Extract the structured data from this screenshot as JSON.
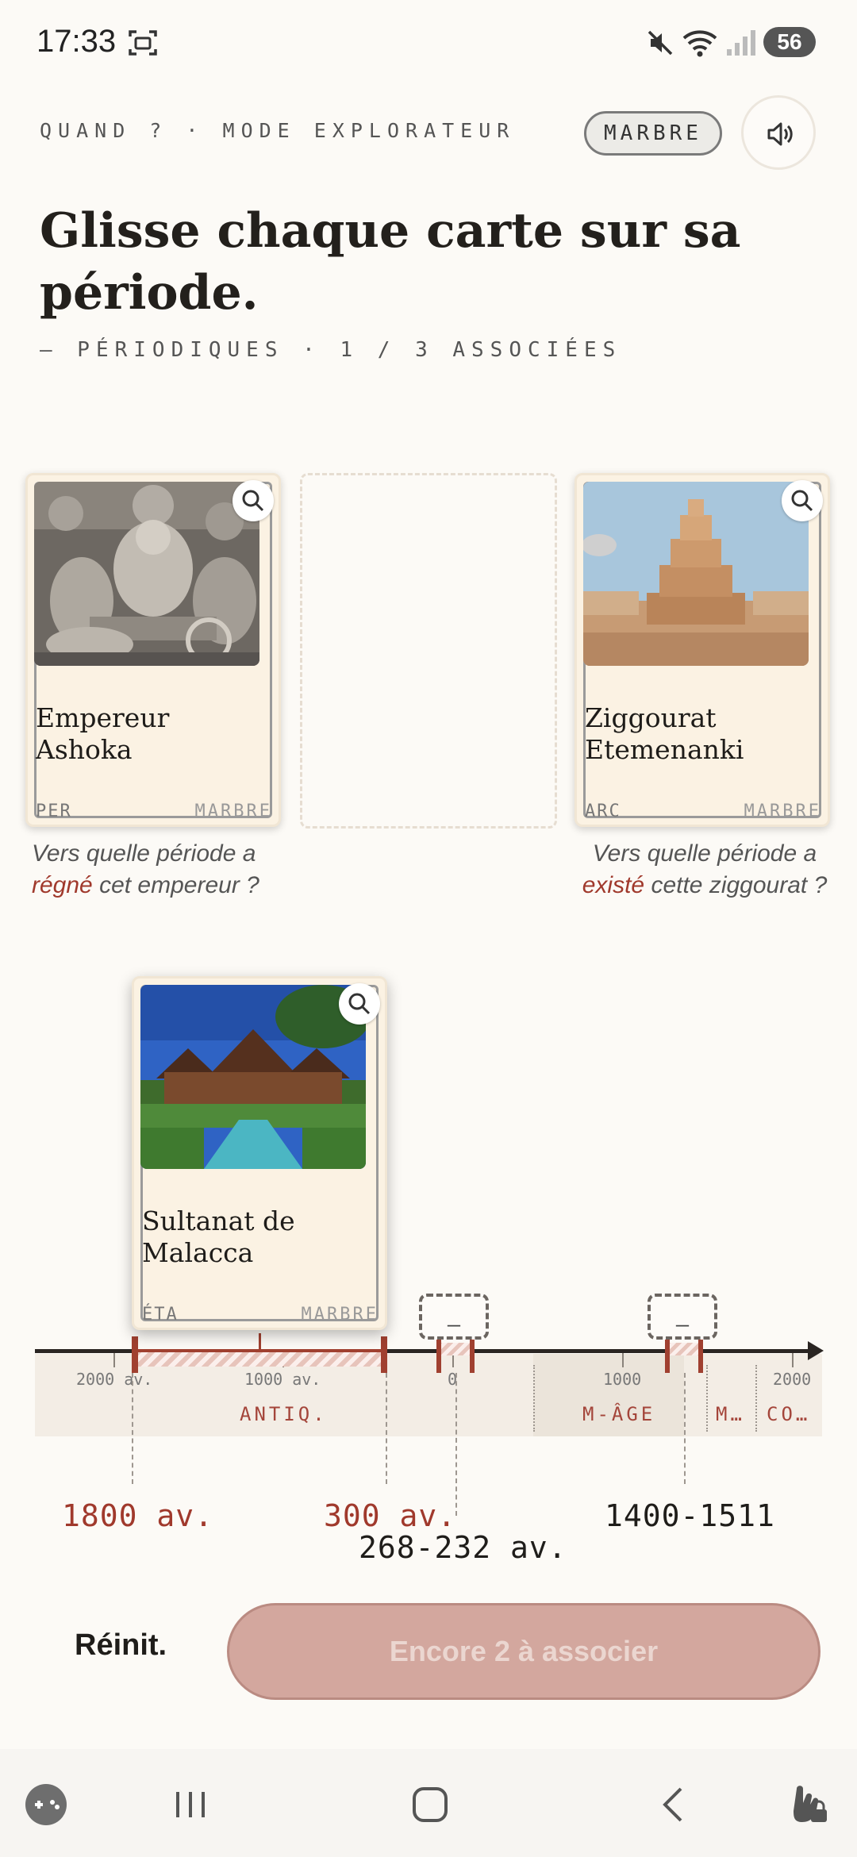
{
  "status_bar": {
    "time": "17:33",
    "battery": "56"
  },
  "header": {
    "eyebrow": "QUAND ? · MODE EXPLORATEUR",
    "mode_chip": "MARBRE",
    "title": "Glisse chaque carte sur sa période.",
    "subtitle": "— PÉRIODIQUES · 1 / 3 ASSOCIÉES"
  },
  "cards": [
    {
      "name": "Empereur Ashoka",
      "category": "PER",
      "tag": "MARBRE",
      "question_pre": "Vers quelle période a ",
      "question_hl": "régné",
      "question_post": " cet empereur ?"
    },
    {
      "name": "Ziggourat Etemenanki",
      "category": "ARC",
      "tag": "MARBRE",
      "question_pre": "Vers quelle période a ",
      "question_hl": "existé",
      "question_post": " cette ziggourat ?"
    },
    {
      "name": "Sultanat de Malacca",
      "category": "ÉTA",
      "tag": "MARBRE"
    }
  ],
  "timeline": {
    "ticks": [
      "2000 av.",
      "1000 av.",
      "0",
      "1000",
      "2000"
    ],
    "eras": [
      "ANTIQ.",
      "M-ÂGE",
      "M…",
      "CO…"
    ],
    "flag_placeholder": "_",
    "dates": {
      "start": "1800 av.",
      "end": "300 av.",
      "ashoka": "268-232 av.",
      "malacca": "1400-1511"
    }
  },
  "actions": {
    "reset": "Réinit.",
    "submit": "Encore 2 à associer"
  },
  "colors": {
    "accent": "#a04030",
    "background": "#fcfaf6",
    "cta": "#d3a79e"
  }
}
